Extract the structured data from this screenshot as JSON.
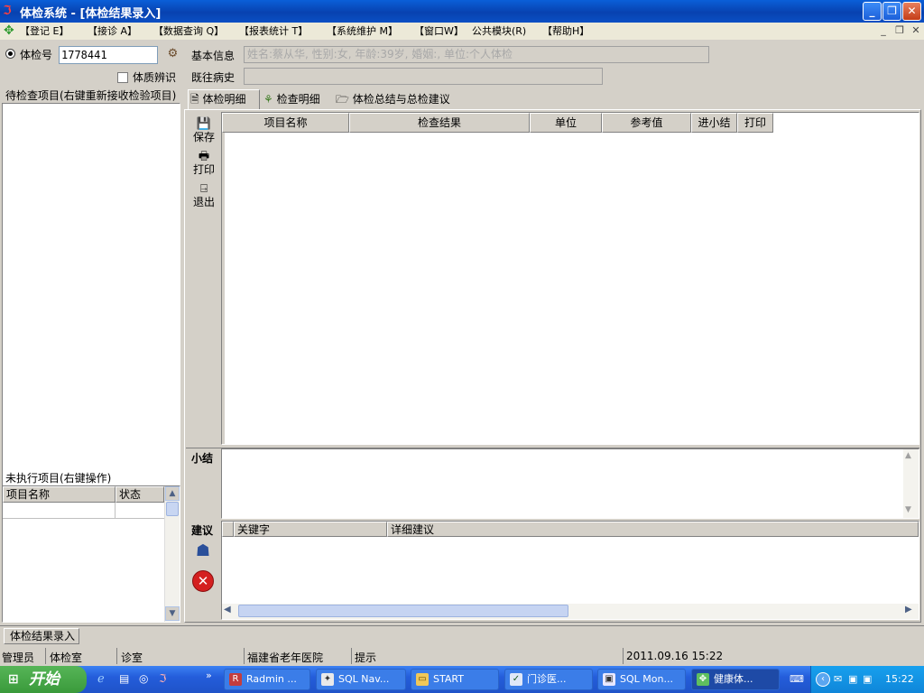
{
  "window": {
    "title": "体检系统 - [体检结果录入]",
    "controls": [
      "_",
      "❐",
      "✕"
    ]
  },
  "menu": {
    "items": [
      "【登记 E】",
      "【接诊 A】",
      "【数据查询 Q】",
      "【报表统计 T】",
      "【系统维护 M】",
      "【窗口W】",
      "公共模块(R)",
      "【帮助H】"
    ],
    "mdi_controls": [
      "_",
      "❐",
      "✕"
    ]
  },
  "left": {
    "exam_no_label": "体检号",
    "exam_no_value": "1778441",
    "constitution_label": "体质辨识",
    "pending_items_title": "待检查项目(右键重新接收检验项目)",
    "unexecuted_title": "未执行项目(右键操作)",
    "unexecuted_columns": [
      "项目名称",
      "状态"
    ]
  },
  "info": {
    "basic_label": "基本信息",
    "basic_value": "姓名:蔡从华, 性别:女, 年龄:39岁, 婚姻:, 单位:个人体检",
    "history_label": "既往病史",
    "history_value": ""
  },
  "tabs": [
    "体检明细",
    "检查明细",
    "体检总结与总检建议"
  ],
  "toolbar": {
    "save": "保存",
    "print": "打印",
    "exit": "退出"
  },
  "grid": {
    "columns": [
      "项目名称",
      "检查结果",
      "单位",
      "参考值",
      "进小结",
      "打印"
    ]
  },
  "summary": {
    "label": "小结",
    "advice_label": "建议",
    "advice_columns": [
      "关键字",
      "详细建议"
    ]
  },
  "mdi_tab": "体检结果录入",
  "status": {
    "user": "管理员",
    "dept": "体检室",
    "room": "诊室",
    "hospital": "福建省老年医院",
    "hint": "提示",
    "datetime": "2011.09.16 15:22"
  },
  "taskbar": {
    "start": "开始",
    "buttons": [
      "Radmin ...",
      "SQL Nav...",
      "START",
      "门诊医...",
      "SQL Mon...",
      "健康体..."
    ],
    "clock": "15:22"
  }
}
